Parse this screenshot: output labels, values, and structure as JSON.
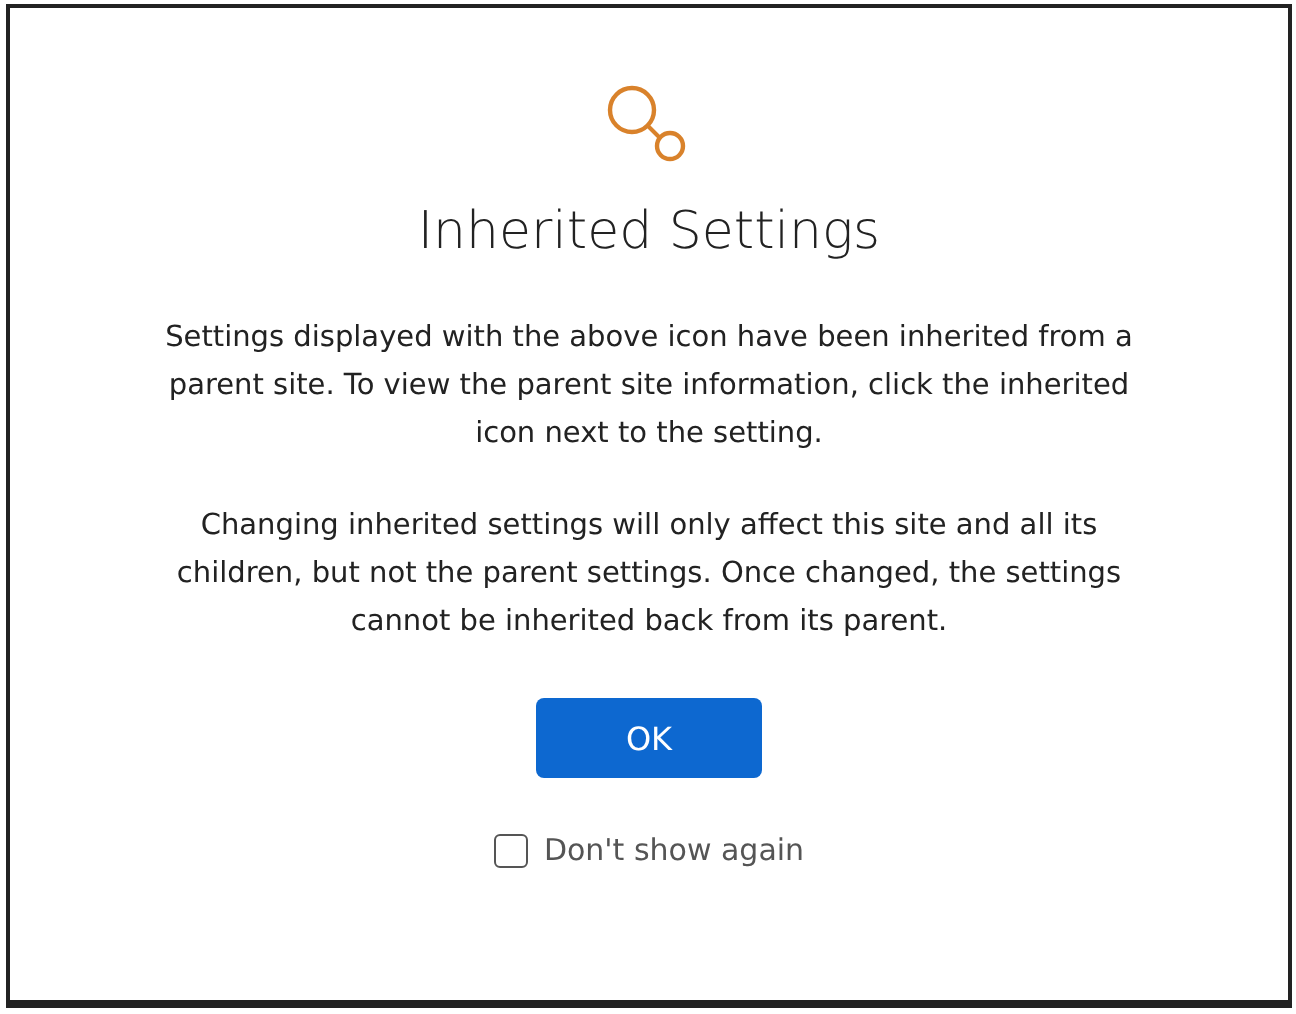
{
  "dialog": {
    "title": "Inherited Settings",
    "paragraphs": [
      "Settings displayed with the above icon have been inherited from a parent site. To view the parent site information, click the inherited icon next to the setting.",
      "Changing inherited settings will only affect this site and all its children, but not the parent settings. Once changed, the settings cannot be inherited back from its parent."
    ],
    "ok_button": "OK",
    "dont_show_again": {
      "label": "Don't show again",
      "checked": false
    }
  }
}
